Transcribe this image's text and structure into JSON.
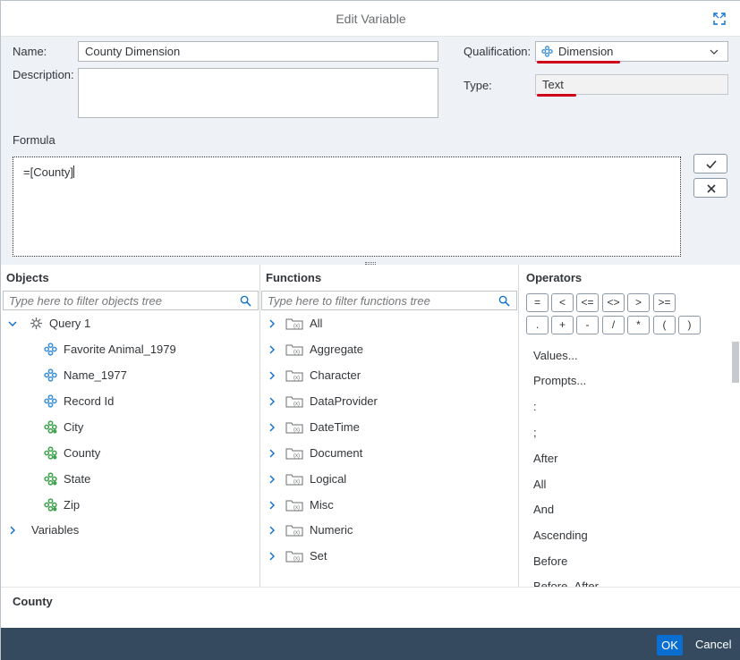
{
  "dialog": {
    "title": "Edit Variable"
  },
  "form": {
    "name_label": "Name:",
    "name_value": "County Dimension",
    "description_label": "Description:",
    "description_value": "",
    "qualification_label": "Qualification:",
    "qualification_value": "Dimension",
    "type_label": "Type:",
    "type_value": "Text",
    "formula_label": "Formula",
    "formula_value": "=[County]"
  },
  "objects": {
    "header": "Objects",
    "filter_placeholder": "Type here to filter objects tree",
    "items": [
      {
        "label": "Query 1",
        "kind": "query-icon"
      },
      {
        "label": "Favorite Animal_1979",
        "kind": "dimension-icon"
      },
      {
        "label": "Name_1977",
        "kind": "dimension-icon"
      },
      {
        "label": "Record Id",
        "kind": "dimension-icon"
      },
      {
        "label": "City",
        "kind": "geo-dimension-icon"
      },
      {
        "label": "County",
        "kind": "geo-dimension-icon"
      },
      {
        "label": "State",
        "kind": "geo-dimension-icon"
      },
      {
        "label": "Zip",
        "kind": "geo-dimension-icon"
      },
      {
        "label": "Variables",
        "kind": "folder"
      }
    ]
  },
  "functions": {
    "header": "Functions",
    "filter_placeholder": "Type here to filter functions tree",
    "items": [
      "All",
      "Aggregate",
      "Character",
      "DataProvider",
      "DateTime",
      "Document",
      "Logical",
      "Misc",
      "Numeric",
      "Set"
    ]
  },
  "operators": {
    "header": "Operators",
    "row1": [
      "=",
      "<",
      "<=",
      "<>",
      ">",
      ">="
    ],
    "row2": [
      ".",
      "+",
      "-",
      "/",
      "*",
      "(",
      ")"
    ],
    "list": [
      "Values...",
      "Prompts...",
      ":",
      ";",
      "After",
      "All",
      "And",
      "Ascending",
      "Before",
      "Before_After"
    ]
  },
  "status": {
    "selected": "County"
  },
  "footer": {
    "ok_label": "OK",
    "cancel_label": "Cancel"
  },
  "colors": {
    "accent": "#0a6ed1",
    "footer": "#354a5f",
    "panel": "#eef2f7",
    "highlight": "#d0021b",
    "dimension": "#3b8fd6",
    "geo": "#3fa34d"
  }
}
